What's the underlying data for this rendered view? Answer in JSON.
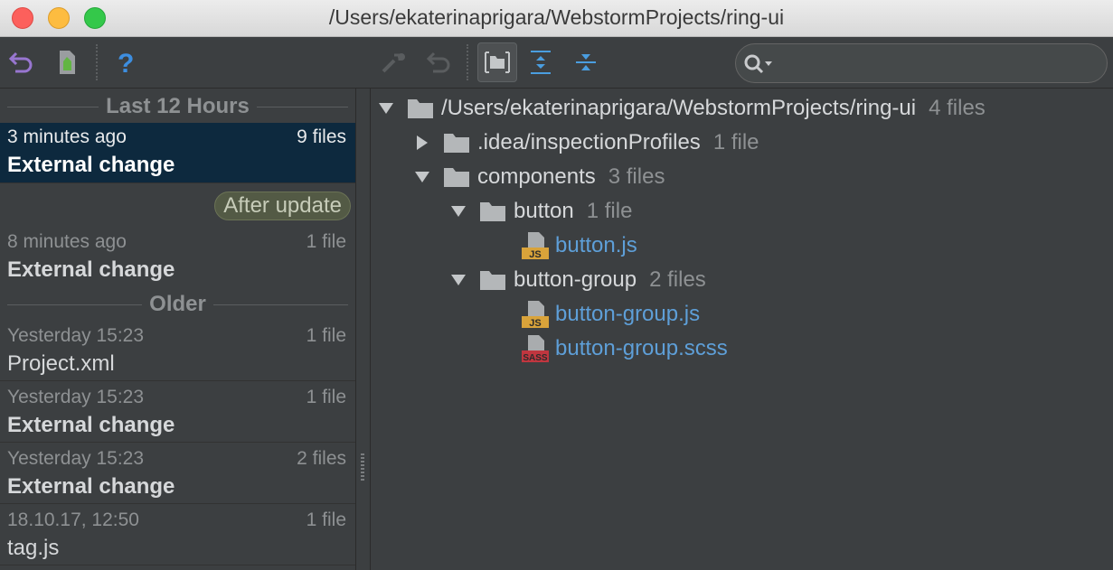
{
  "window": {
    "title": "/Users/ekaterinaprigara/WebstormProjects/ring-ui"
  },
  "toolbar": {
    "left_icons": [
      "undo-icon",
      "patch-icon",
      "help-icon"
    ],
    "right_icons": [
      "revert-icon",
      "undo-icon",
      "group-by-directory-icon",
      "expand-all-icon",
      "collapse-all-icon"
    ],
    "search_placeholder": ""
  },
  "history": {
    "group_recent": "Last 12 Hours",
    "group_older": "Older",
    "badge": "After update",
    "entries": [
      {
        "time": "3 minutes ago",
        "files": "9 files",
        "name": "External change"
      },
      {
        "time": "8 minutes ago",
        "files": "1 file",
        "name": "External change"
      },
      {
        "time": "Yesterday 15:23",
        "files": "1 file",
        "name": "Project.xml"
      },
      {
        "time": "Yesterday 15:23",
        "files": "1 file",
        "name": "External change"
      },
      {
        "time": "Yesterday 15:23",
        "files": "2 files",
        "name": "External change"
      },
      {
        "time": "18.10.17, 12:50",
        "files": "1 file",
        "name": "tag.js"
      }
    ]
  },
  "tree": {
    "root": {
      "name": "/Users/ekaterinaprigara/WebstormProjects/ring-ui",
      "count": "4 files"
    },
    "idea": {
      "name": ".idea/inspectionProfiles",
      "count": "1 file"
    },
    "components": {
      "name": "components",
      "count": "3 files"
    },
    "button": {
      "name": "button",
      "count": "1 file"
    },
    "button_js": {
      "name": "button.js",
      "type": "JS"
    },
    "button_group": {
      "name": "button-group",
      "count": "2 files"
    },
    "button_group_js": {
      "name": "button-group.js",
      "type": "JS"
    },
    "button_group_scss": {
      "name": "button-group.scss",
      "type": "SASS"
    }
  },
  "colors": {
    "selection": "#0d293e",
    "link": "#5e9fd8",
    "background": "#3c3f41"
  }
}
